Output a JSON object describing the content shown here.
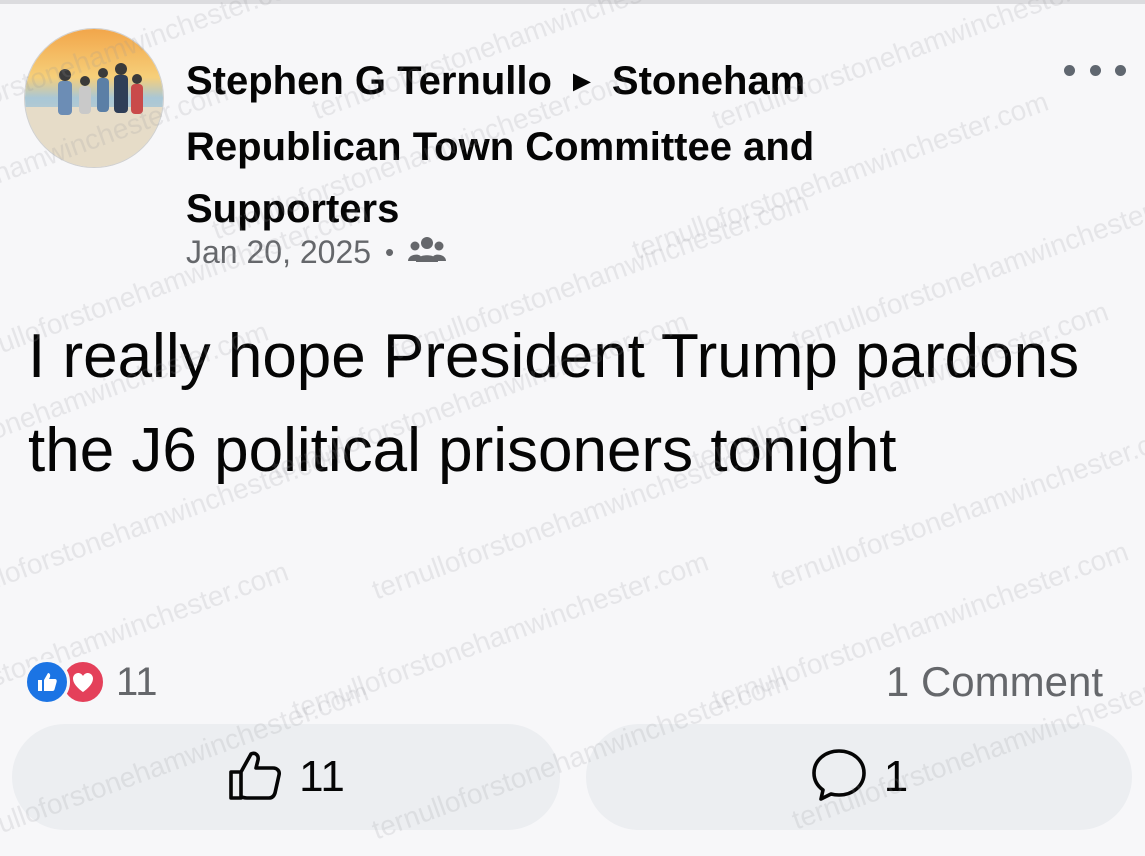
{
  "post": {
    "author": "Stephen G Ternullo",
    "arrow": "►",
    "group": "Stoneham Republican Town Committee and Supporters",
    "date": "Jan 20, 2025",
    "separator": "•",
    "audience_icon": "group-icon",
    "text": "I really hope President Trump pardons the J6 political prisoners tonight"
  },
  "reactions": {
    "count": "11",
    "types": [
      "like",
      "love"
    ]
  },
  "comments": {
    "summary": "1 Comment"
  },
  "actions": {
    "like_count": "11",
    "comment_count": "1"
  },
  "watermark": {
    "text": "ternulloforstonehamwinchester.com"
  },
  "colors": {
    "like": "#1b74e4",
    "love": "#e4405a",
    "secondary_text": "#65676b"
  }
}
